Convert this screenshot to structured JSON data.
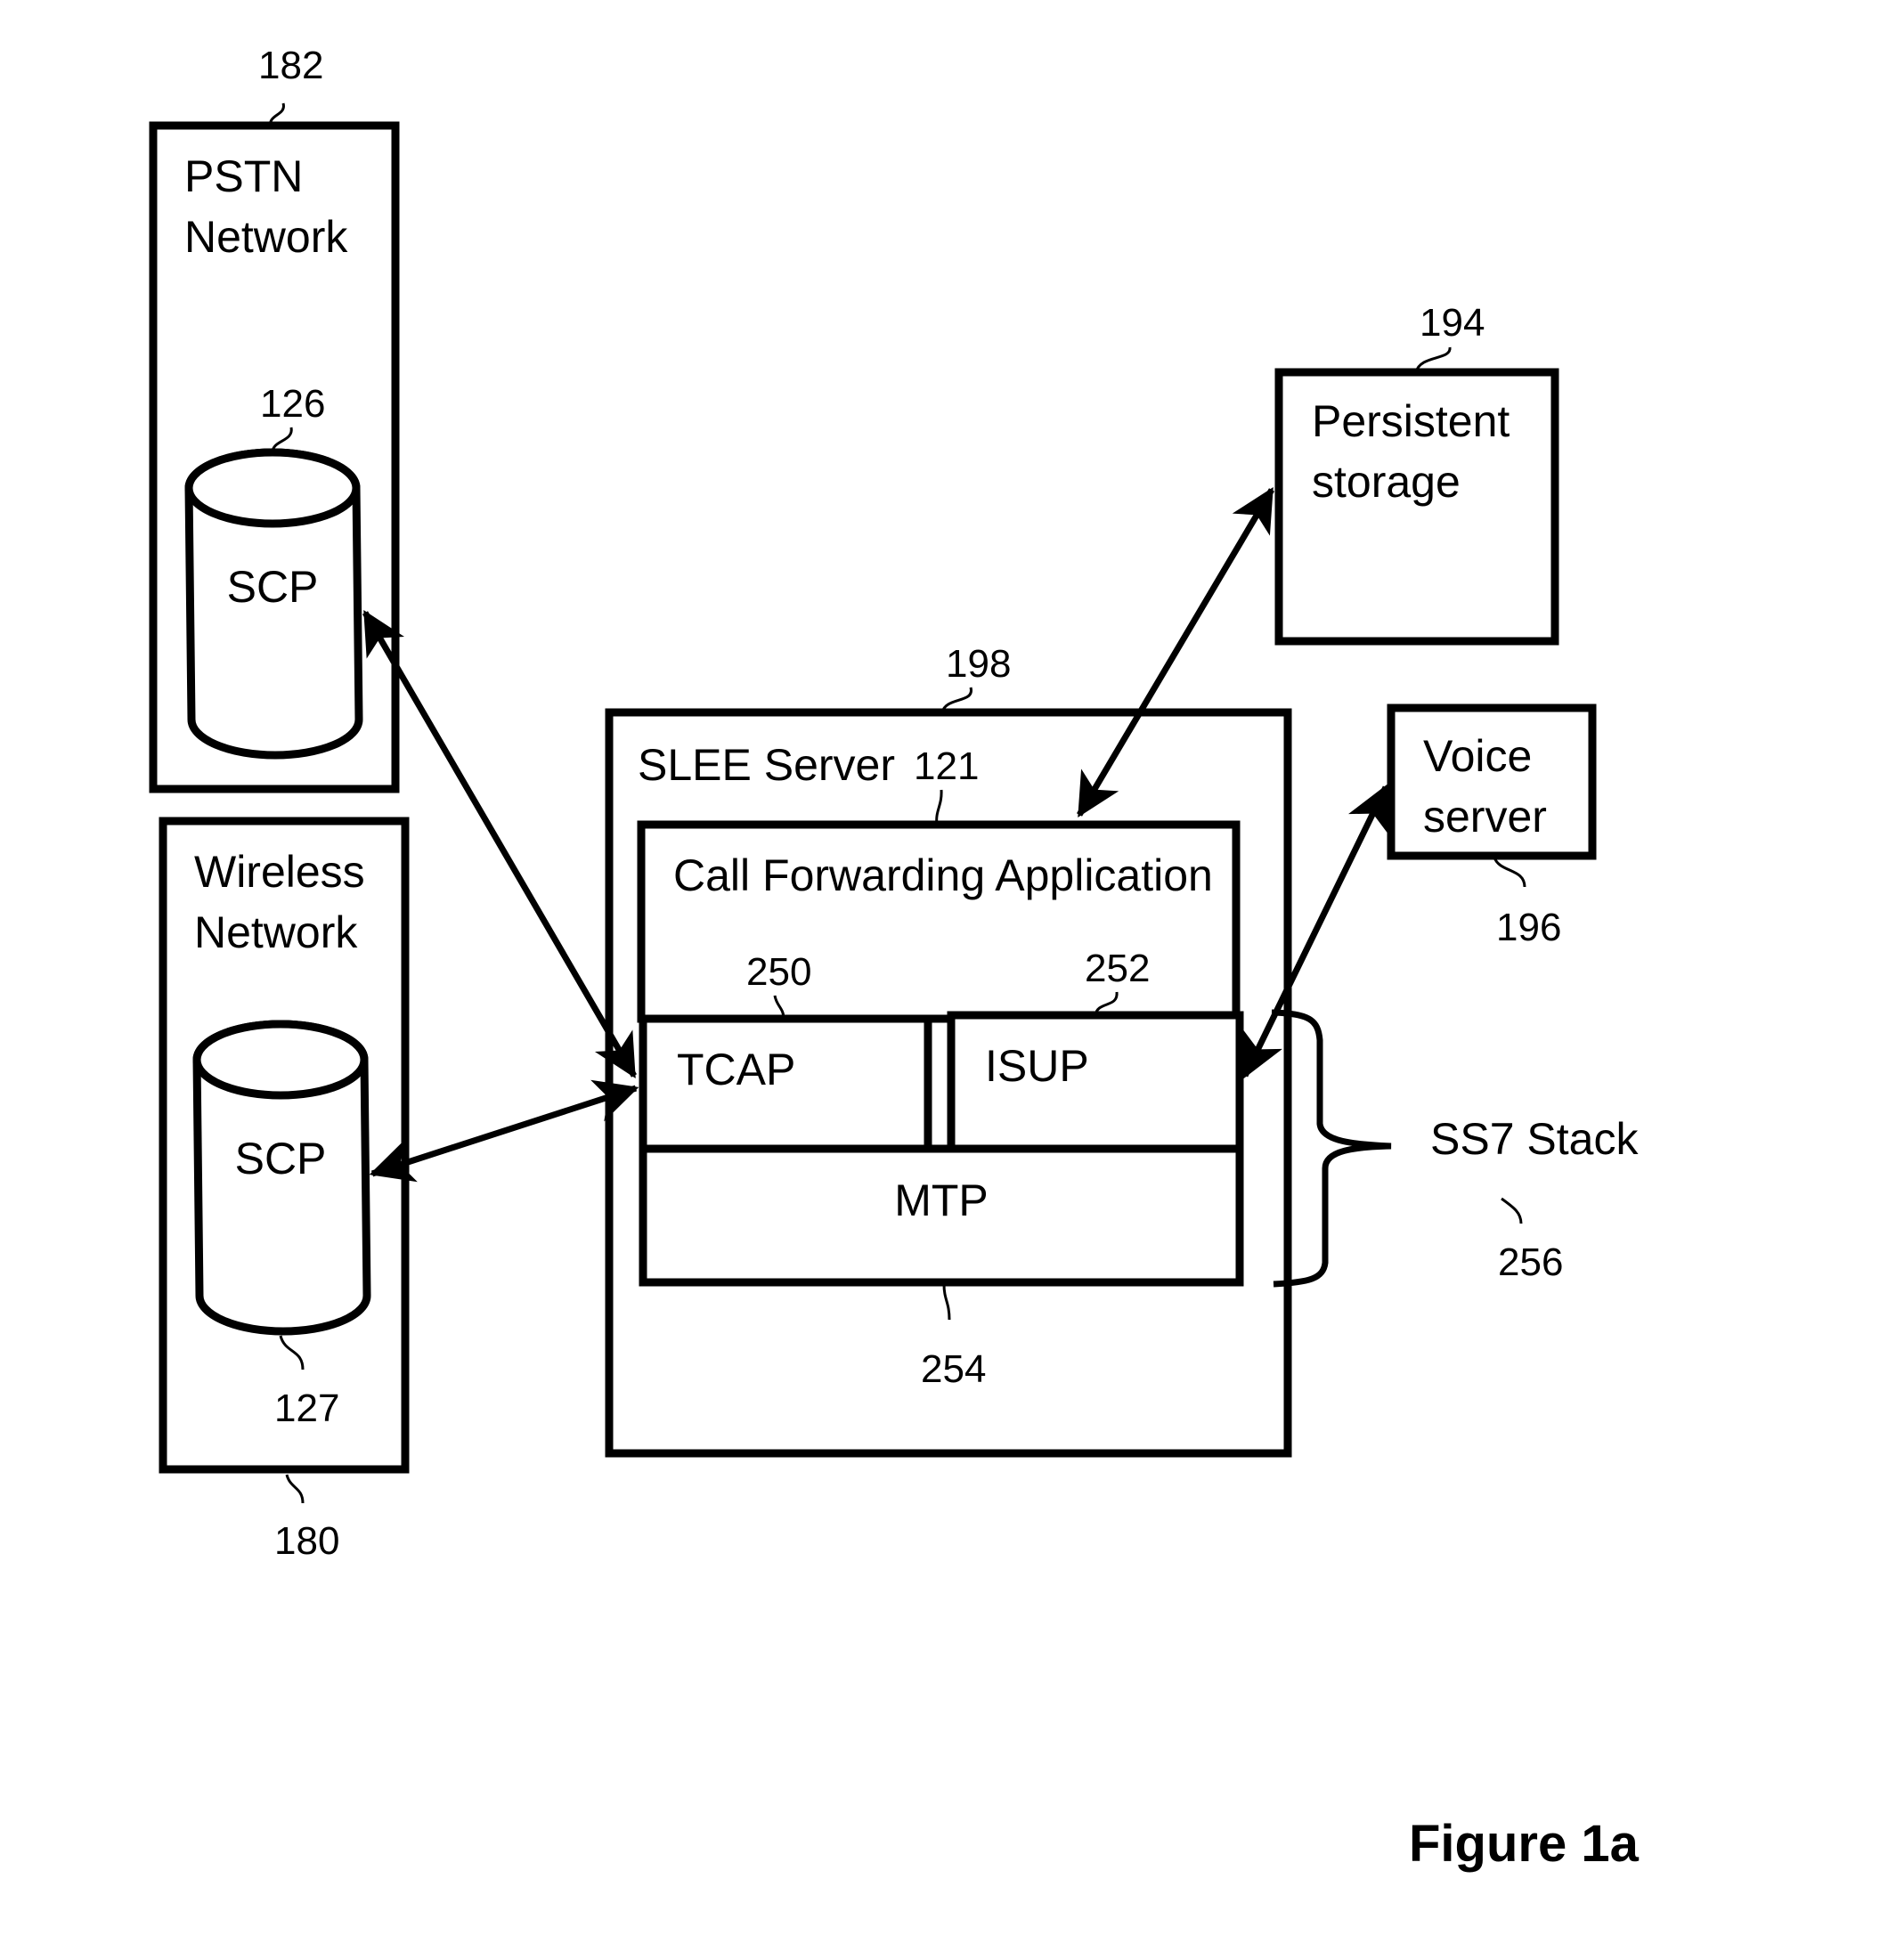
{
  "figure": {
    "caption": "Figure 1a"
  },
  "nodes": {
    "pstn": {
      "label_line1": "PSTN",
      "label_line2": "Network",
      "ref": "182"
    },
    "pstn_scp": {
      "label": "SCP",
      "ref": "126"
    },
    "wireless": {
      "label_line1": "Wireless",
      "label_line2": "Network",
      "ref": "180"
    },
    "wireless_scp": {
      "label": "SCP",
      "ref": "127"
    },
    "slee": {
      "label": "SLEE Server",
      "ref": "198"
    },
    "call_forwarding": {
      "label": "Call Forwarding Application",
      "ref": "121"
    },
    "tcap": {
      "label": "TCAP",
      "ref": "250"
    },
    "isup": {
      "label": "ISUP",
      "ref": "252"
    },
    "mtp": {
      "label": "MTP",
      "ref": "254"
    },
    "persistent_storage": {
      "label_line1": "Persistent",
      "label_line2": "storage",
      "ref": "194"
    },
    "voice_server": {
      "label_line1": "Voice",
      "label_line2": "server",
      "ref": "196"
    },
    "ss7_stack": {
      "label": "SS7 Stack",
      "ref": "256"
    }
  },
  "connections": [
    {
      "from": "pstn_scp",
      "to": "tcap",
      "type": "bidirectional"
    },
    {
      "from": "wireless_scp",
      "to": "tcap",
      "type": "bidirectional"
    },
    {
      "from": "persistent_storage",
      "to": "call_forwarding",
      "type": "bidirectional"
    },
    {
      "from": "voice_server",
      "to": "isup",
      "type": "bidirectional"
    }
  ],
  "groupings": [
    {
      "name": "ss7_stack",
      "members": [
        "tcap",
        "isup",
        "mtp"
      ],
      "marker": "brace"
    }
  ]
}
